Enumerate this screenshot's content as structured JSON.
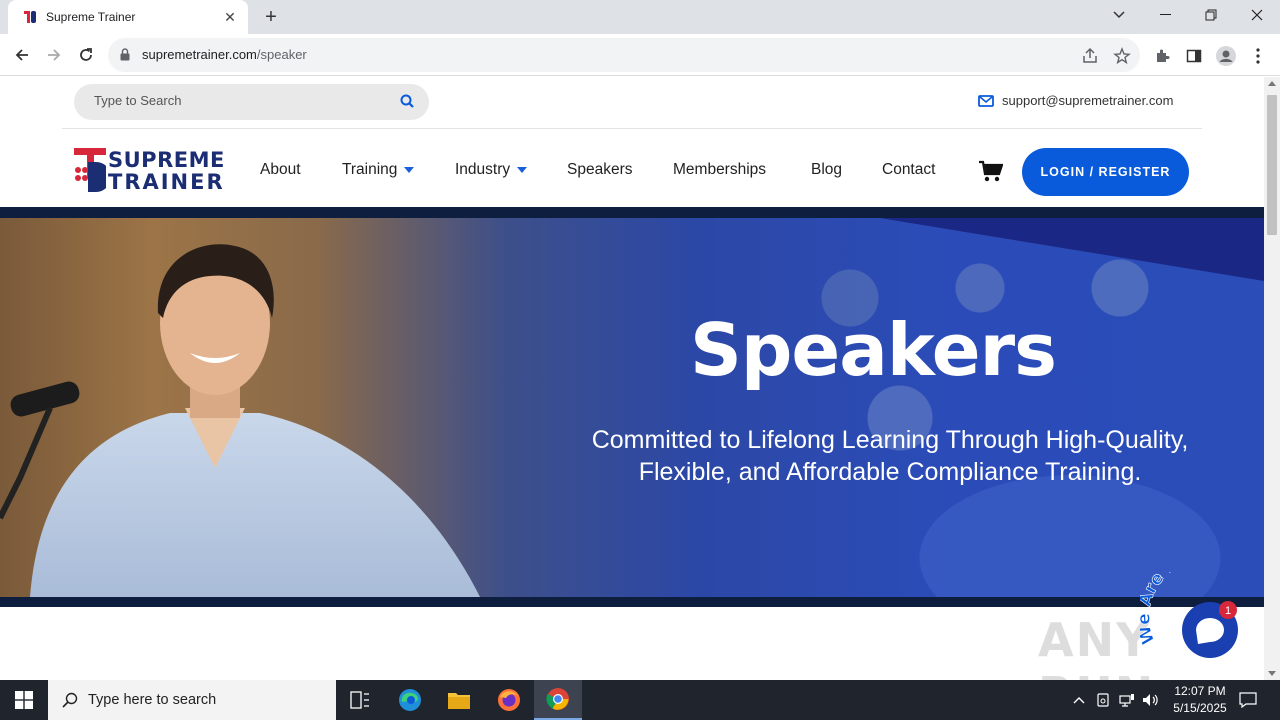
{
  "browser": {
    "tab_title": "Supreme Trainer",
    "url_domain": "supremetrainer.com",
    "url_path": "/speaker"
  },
  "site": {
    "search_placeholder": "Type to Search",
    "support_email": "support@supremetrainer.com",
    "logo_line1": "SUPREME",
    "logo_line2": "TRAINER",
    "nav": [
      {
        "label": "About"
      },
      {
        "label": "Training"
      },
      {
        "label": "Industry"
      },
      {
        "label": "Speakers"
      },
      {
        "label": "Memberships"
      },
      {
        "label": "Blog"
      },
      {
        "label": "Contact"
      }
    ],
    "login_label": "LOGIN / REGISTER"
  },
  "hero": {
    "title": "Speakers",
    "subtitle_line1": "Committed to Lifelong Learning Through High-Quality,",
    "subtitle_line2": "Flexible, and Affordable Compliance Training."
  },
  "chat": {
    "label": "We Are Here!",
    "badge": "1"
  },
  "watermark": "ANY RUN",
  "taskbar": {
    "search_placeholder": "Type here to search",
    "time": "12:07 PM",
    "date": "5/15/2025"
  },
  "colors": {
    "brand_blue": "#0a5bdb",
    "logo_navy": "#1b2d73",
    "logo_red": "#d6283a",
    "hero_blue": "#2b4cb8"
  }
}
